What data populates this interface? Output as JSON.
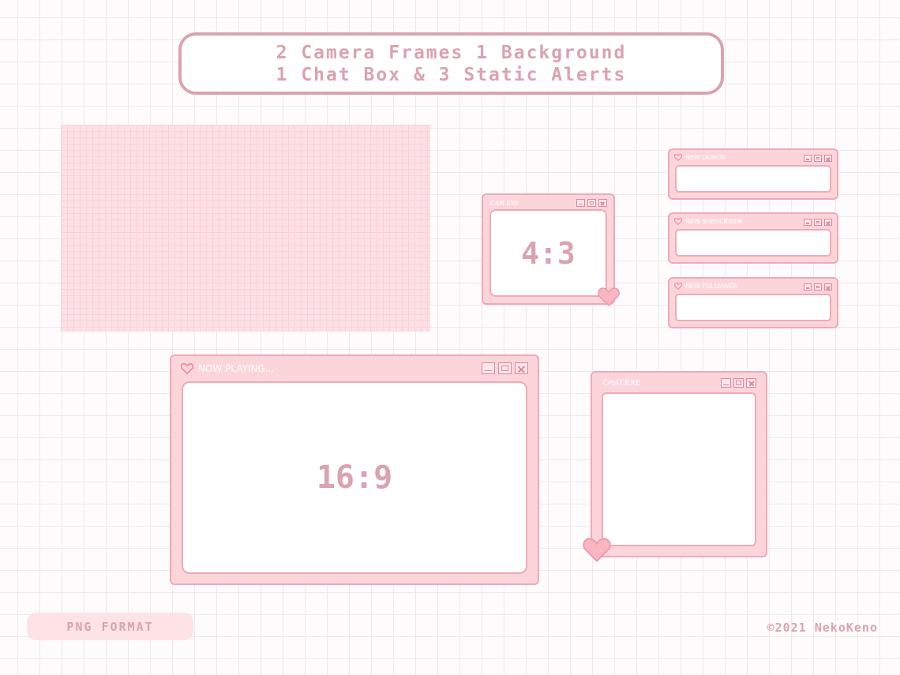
{
  "header": {
    "line1": "2 Camera Frames 1 Background",
    "line2": "1 Chat Box & 3 Static Alerts"
  },
  "cam_window": {
    "title": "CAM.EXE",
    "ratio": "4:3"
  },
  "alerts": [
    {
      "title": "NEW DONOR"
    },
    {
      "title": "NEW SUBSCRIBER"
    },
    {
      "title": "NEW FOLLOWER"
    }
  ],
  "now_playing_window": {
    "title": "NOW PLAYING...",
    "ratio": "16:9"
  },
  "chat_window": {
    "title": "CHAT.EXE"
  },
  "footer": {
    "format_badge": "PNG FORMAT",
    "copyright": "©2021 NekoKeno"
  },
  "colors": {
    "accent": "#d9a3b0",
    "window_fill": "#fcd5db",
    "window_border": "#f0a9b6"
  },
  "icons": [
    "heart-icon",
    "minimize-icon",
    "maximize-icon",
    "close-icon"
  ]
}
